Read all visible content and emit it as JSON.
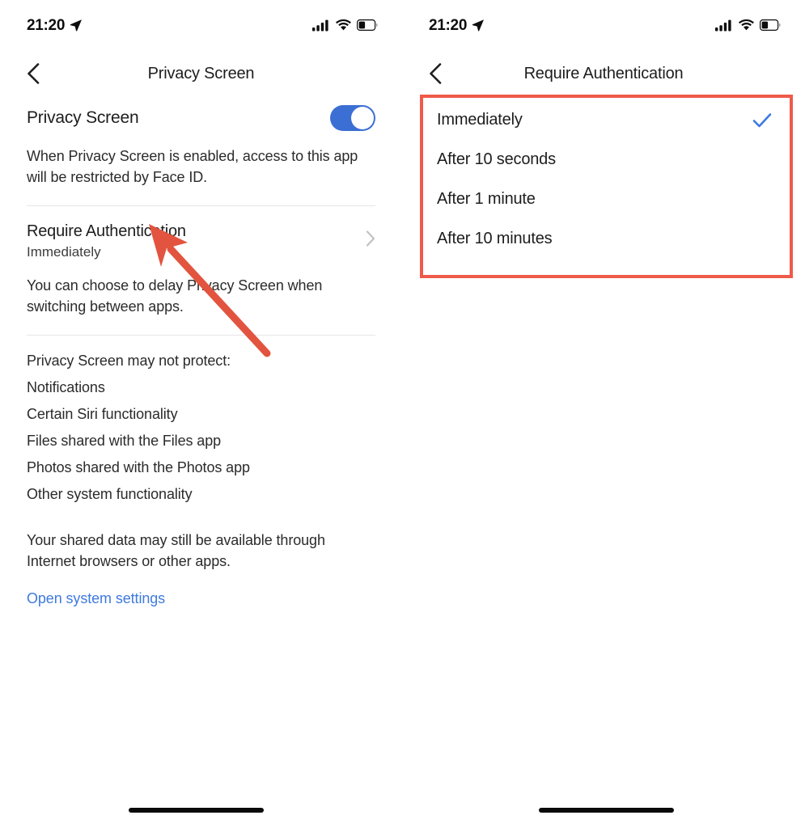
{
  "status_bar": {
    "time": "21:20",
    "location_icon": "location-arrow-icon",
    "cellular_icon": "cellular-signal-icon",
    "wifi_icon": "wifi-icon",
    "battery_icon": "battery-low-icon"
  },
  "left_screen": {
    "nav": {
      "back_icon": "chevron-left-icon",
      "title": "Privacy Screen"
    },
    "toggle_row": {
      "label": "Privacy Screen",
      "enabled": true,
      "accent_color": "#3b6fd4"
    },
    "description": "When Privacy Screen is enabled, access to this app will be restricted by Face ID.",
    "require_auth_row": {
      "title": "Require Authentication",
      "value": "Immediately",
      "chevron_icon": "chevron-right-icon"
    },
    "delay_description": "You can choose to delay Privacy Screen when switching between apps.",
    "not_protect_heading": "Privacy Screen may not protect:",
    "not_protect_items": [
      "Notifications",
      "Certain Siri functionality",
      "Files shared with the Files app",
      "Photos shared with the Photos app",
      "Other system functionality"
    ],
    "shared_data_note": "Your shared data may still be available through Internet browsers or other apps.",
    "system_settings_link": "Open system settings",
    "link_color": "#3f7ae0"
  },
  "right_screen": {
    "nav": {
      "back_icon": "chevron-left-icon",
      "title": "Require Authentication"
    },
    "options": [
      {
        "label": "Immediately",
        "selected": true
      },
      {
        "label": "After 10 seconds",
        "selected": false
      },
      {
        "label": "After 1 minute",
        "selected": false
      },
      {
        "label": "After 10 minutes",
        "selected": false
      }
    ],
    "checkmark_icon": "checkmark-icon",
    "checkmark_color": "#3b7ae4"
  },
  "annotations": {
    "highlight_box_color": "#ef5a4a",
    "arrow_color": "#e2543f"
  }
}
